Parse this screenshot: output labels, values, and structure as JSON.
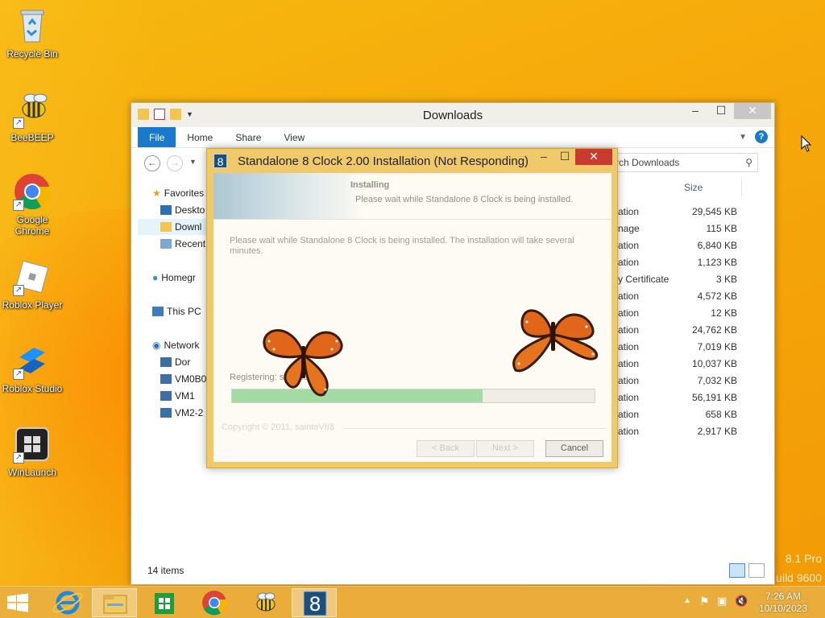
{
  "desktop": {
    "icons": [
      {
        "label": "Recycle Bin"
      },
      {
        "label": "BeeBEEP"
      },
      {
        "label": "Google Chrome"
      },
      {
        "label": "Roblox Player"
      },
      {
        "label": "Roblox Studio"
      },
      {
        "label": "WinLaunch"
      }
    ],
    "watermark_line1": "8.1 Pro",
    "watermark_line2": "uild 9600"
  },
  "explorer": {
    "title": "Downloads",
    "ribbon_tabs": [
      "File",
      "Home",
      "Share",
      "View"
    ],
    "search_placeholder": "rch Downloads",
    "column_size": "Size",
    "nav": [
      "Favorites",
      "Deskto",
      "Downl",
      "Recent",
      "Homegr",
      "This PC",
      "Network",
      "Dor",
      "VM0B0",
      "VM1",
      "VM2-2"
    ],
    "files": [
      {
        "type": "ation",
        "size": "29,545 KB"
      },
      {
        "type": "nage",
        "size": "115 KB"
      },
      {
        "type": "ation",
        "size": "6,840 KB"
      },
      {
        "type": "ation",
        "size": "1,123 KB"
      },
      {
        "type": "y Certificate",
        "size": "3 KB"
      },
      {
        "type": "ation",
        "size": "4,572 KB"
      },
      {
        "type": "ation",
        "size": "12 KB"
      },
      {
        "type": "ation",
        "size": "24,762 KB"
      },
      {
        "type": "ation",
        "size": "7,019 KB"
      },
      {
        "type": "ation",
        "size": "10,037 KB"
      },
      {
        "type": "ation",
        "size": "7,032 KB"
      },
      {
        "type": "ation",
        "size": "56,191 KB"
      },
      {
        "type": "ation",
        "size": "658 KB"
      },
      {
        "type": "ation",
        "size": "2,917 KB"
      }
    ],
    "status": "14 items"
  },
  "installer": {
    "logo": "8",
    "title": "Standalone 8 Clock 2.00 Installation (Not Responding)",
    "header_title": "Installing",
    "header_sub": "Please wait while Standalone 8 Clock is being installed.",
    "description": "Please wait while Standalone 8 Clock is being installed. The installation will take several minutes.",
    "status": "Registering: segoeui.t",
    "progress": 0.69,
    "copyright": "Copyright © 2011, sainteVII8",
    "buttons": {
      "back": "< Back",
      "next": "Next >",
      "cancel": "Cancel"
    }
  },
  "taskbar": {
    "time": "7:26 AM",
    "date": "10/10/2023"
  }
}
